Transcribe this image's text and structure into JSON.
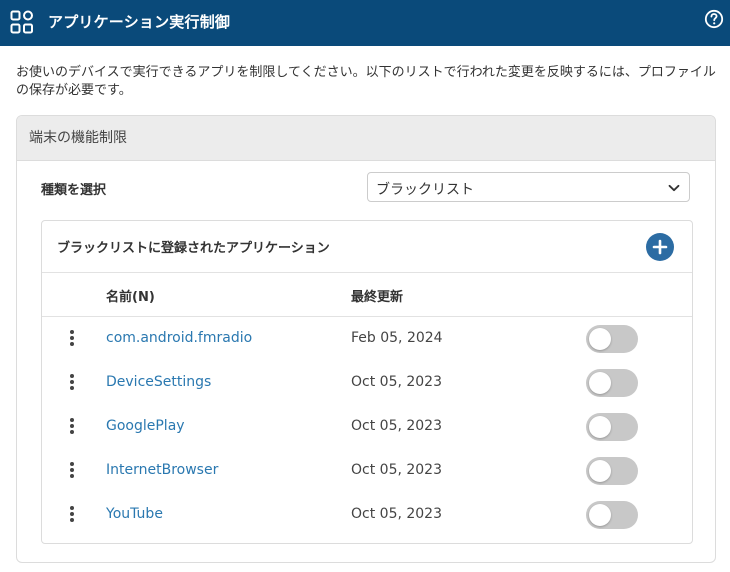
{
  "header": {
    "title": "アプリケーション実行制御",
    "icon": "apps-grid-icon",
    "help_icon": "help-circle-icon"
  },
  "description": "お使いのデバイスで実行できるアプリを制限してください。以下のリストで行われた変更を反映するには、プロファイルの保存が必要です。",
  "panel": {
    "title": "端末の機能制限",
    "type_label": "種類を選択",
    "type_select": {
      "value": "ブラックリスト"
    },
    "list": {
      "title": "ブラックリストに登録されたアプリケーション",
      "columns": {
        "name": "名前(N)",
        "updated": "最終更新"
      },
      "rows": [
        {
          "name": "com.android.fmradio",
          "updated": "Feb 05, 2024",
          "enabled": false
        },
        {
          "name": "DeviceSettings",
          "updated": "Oct 05, 2023",
          "enabled": false
        },
        {
          "name": "GooglePlay",
          "updated": "Oct 05, 2023",
          "enabled": false
        },
        {
          "name": "InternetBrowser",
          "updated": "Oct 05, 2023",
          "enabled": false
        },
        {
          "name": "YouTube",
          "updated": "Oct 05, 2023",
          "enabled": false
        }
      ]
    }
  },
  "colors": {
    "header_bg": "#0a4a7a",
    "accent": "#2c6ca3",
    "link": "#2a78b0",
    "toggle_off": "#c8c8c8"
  }
}
